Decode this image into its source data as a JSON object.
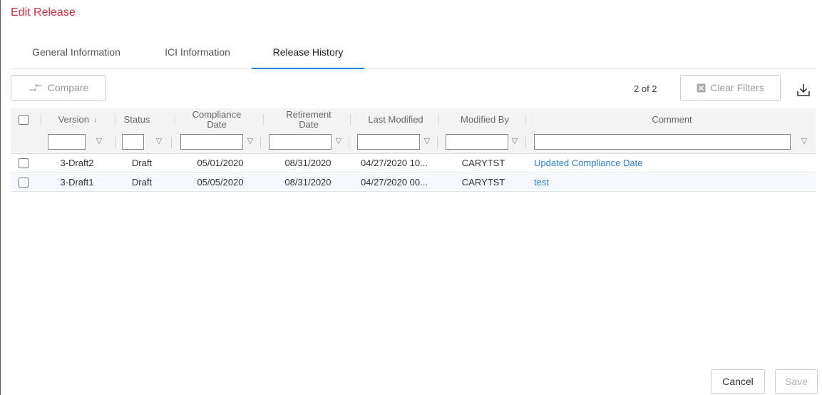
{
  "dialog": {
    "title": "Edit Release"
  },
  "tabs": [
    {
      "label": "General Information",
      "active": false
    },
    {
      "label": "ICI Information",
      "active": false
    },
    {
      "label": "Release History",
      "active": true
    }
  ],
  "toolbar": {
    "compare_label": "Compare",
    "record_count": "2 of 2",
    "clear_filters_label": "Clear Filters",
    "download_icon": "download-icon"
  },
  "table": {
    "columns": {
      "version": "Version",
      "status": "Status",
      "compliance_l1": "Compliance",
      "compliance_l2": "Date",
      "retirement_l1": "Retirement",
      "retirement_l2": "Date",
      "last_modified": "Last Modified",
      "modified_by": "Modified By",
      "comment": "Comment"
    },
    "sort_indicator": "↓",
    "rows": [
      {
        "version": "3-Draft2",
        "status": "Draft",
        "compliance_date": "05/01/2020",
        "retirement_date": "08/31/2020",
        "last_modified": "04/27/2020 10...",
        "modified_by": "CARYTST",
        "comment": "Updated Compliance Date"
      },
      {
        "version": "3-Draft1",
        "status": "Draft",
        "compliance_date": "05/05/2020",
        "retirement_date": "08/31/2020",
        "last_modified": "04/27/2020 00...",
        "modified_by": "CARYTST",
        "comment": "test"
      }
    ]
  },
  "footer": {
    "cancel_label": "Cancel",
    "save_label": "Save"
  },
  "colors": {
    "title": "#d32f3f",
    "accent": "#2a7fd4",
    "header_bg": "#f4f4f4"
  }
}
